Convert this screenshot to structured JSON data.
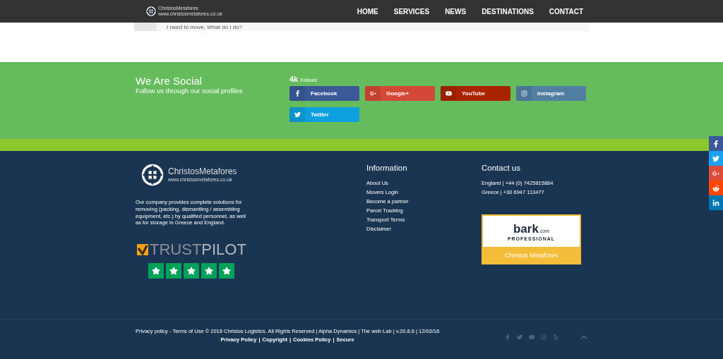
{
  "header": {
    "logo": {
      "name": "ChristosMetafores",
      "url": "www.christosmetafores.co.uk"
    },
    "nav": [
      {
        "label": "HOME"
      },
      {
        "label": "SERVICES"
      },
      {
        "label": "NEWS"
      },
      {
        "label": "DESTINATIONS"
      },
      {
        "label": "CONTACT"
      }
    ]
  },
  "faq": {
    "question": "I need to move. What do I do?"
  },
  "social": {
    "title": "We Are Social",
    "subtitle": "Follow us through our social profiles",
    "count": "4k",
    "count_label": "Follows",
    "buttons": [
      {
        "kind": "facebook",
        "label": "Facebook",
        "color": "#3b5998"
      },
      {
        "kind": "googleplus",
        "label": "Google+",
        "color": "#d34836"
      },
      {
        "kind": "youtube",
        "label": "YouTube",
        "color": "#a82400"
      },
      {
        "kind": "instagram",
        "label": "Instagram",
        "color": "#517fa4"
      },
      {
        "kind": "twitter",
        "label": "Twitter",
        "color": "#0ea0de"
      }
    ]
  },
  "side_share": [
    {
      "kind": "facebook",
      "color": "#3b5998"
    },
    {
      "kind": "twitter",
      "color": "#1da1f2"
    },
    {
      "kind": "googleplus",
      "color": "#dd4b39"
    },
    {
      "kind": "reddit",
      "color": "#ff4500"
    },
    {
      "kind": "linkedin",
      "color": "#0077b5"
    }
  ],
  "footer": {
    "logo": {
      "name": "ChristosMetafores",
      "url": "www.christosmetafores.co.uk"
    },
    "about": "Our company provides complete solutions for removing (packing, dismantling / assembling equipment, etc.) by qualified personnel, as well as for storage in Greece and England.",
    "trustpilot": {
      "brand_1": "TRUST",
      "brand_2": "PILOT",
      "stars": 5
    },
    "information": {
      "title": "Information",
      "links": [
        "About Us",
        "Movers Login",
        "Become a partner",
        "Parcel Tracking",
        "Transport Terms",
        "Disclaimer"
      ]
    },
    "contact": {
      "title": "Contact us",
      "lines": [
        "England | +44 (0) 7425815884",
        "Greece | +30 6947 113477"
      ],
      "bark": {
        "brand": "bark",
        "domain": ".com",
        "tier": "PROFESSIONAL",
        "name": "Christos Metafores"
      }
    },
    "bottom": {
      "copyright": "Privacy policy - Terms of Use © 2018 Christos Logistics. All Rights Reserved | Alpha Dynamics | The web Lab | v.20.8.6 | 12/03/18",
      "links": [
        "Privacy Policy",
        "Copyright",
        "Cookies Policy",
        "Secure"
      ],
      "separator": "|",
      "icons": [
        {
          "kind": "facebook"
        },
        {
          "kind": "twitter"
        },
        {
          "kind": "youtube"
        },
        {
          "kind": "instagram"
        },
        {
          "kind": "yelp"
        }
      ]
    }
  }
}
